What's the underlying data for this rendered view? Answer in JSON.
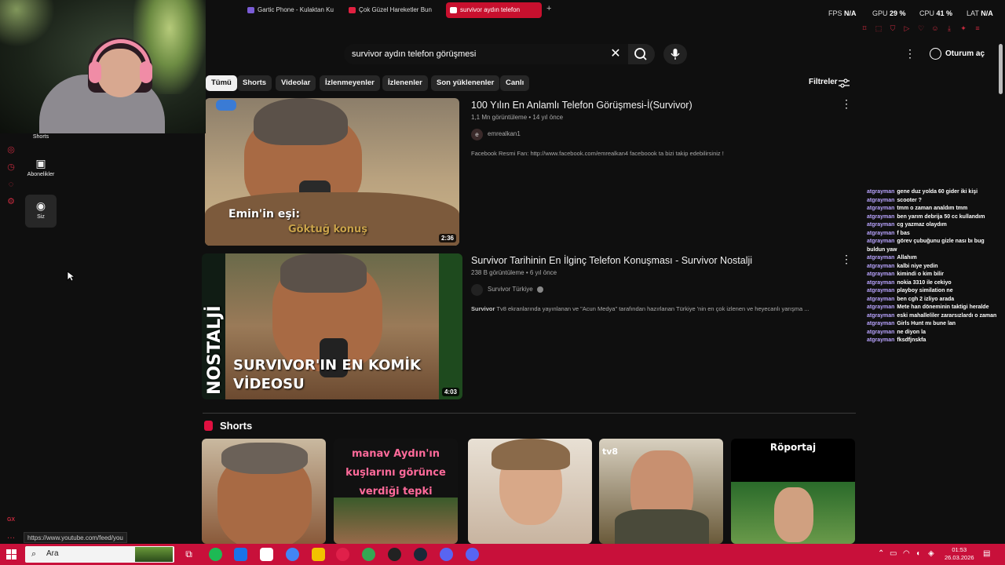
{
  "browser": {
    "tabs": [
      {
        "label": "Gartic Phone - Kulaktan Ku"
      },
      {
        "label": "Çok Güzel Hareketler Bun"
      },
      {
        "label": "survivor aydın telefon"
      }
    ],
    "stats": [
      {
        "label": "FPS",
        "value": "N/A"
      },
      {
        "label": "GPU",
        "value": "29 %"
      },
      {
        "label": "CPU",
        "value": "41 %"
      },
      {
        "label": "LAT",
        "value": "N/A"
      }
    ]
  },
  "sidebar": {
    "shorts_label": "Shorts",
    "subscriptions_label": "Abonelikler",
    "you_label": "Siz"
  },
  "search": {
    "query": "survivor aydın telefon görüşmesi"
  },
  "header": {
    "signin_label": "Oturum aç"
  },
  "chips": [
    "Tümü",
    "Shorts",
    "Videolar",
    "İzlenmeyenler",
    "İzlenenler",
    "Son yüklenenler",
    "Canlı"
  ],
  "filters_label": "Filtreler",
  "results": [
    {
      "title": "100 Yılın En Anlamlı Telefon Görüşmesi-İ(Survivor)",
      "meta": "1,1 Mn görüntüleme • 14 yıl önce",
      "channel": "emrealkan1",
      "channel_initial": "e",
      "description": "Facebook Resmi Fan: http://www.facebook.com/emrealkan4 faceboook ta bizi takip edebilirsiniz !",
      "duration": "2:36",
      "overlay_line1": "Emin'in eşi:",
      "overlay_line2": "Göktuğ konuş"
    },
    {
      "title": "Survivor Tarihinin En İlginç Telefon Konuşması - Survivor Nostalji",
      "meta": "238 B görüntüleme • 6 yıl önce",
      "channel": "Survivor Türkiye",
      "description_bold": "Survivor",
      "description": "Tv8 ekranlarında yayınlanan ve \"Acun Medya\" tarafından hazırlanan Türkiye 'nin en çok izlenen ve heyecanlı yarışma ...",
      "duration": "4:03",
      "overlay_side": "NOSTALJİ",
      "overlay_line1": "SURVIVOR'IN EN KOMİK",
      "overlay_line2": "VİDEOSU"
    }
  ],
  "shorts": {
    "heading": "Shorts",
    "items": [
      {
        "caption": ""
      },
      {
        "caption": "manav Aydın'ın kuşlarını görünce verdiği tepki"
      },
      {
        "caption": ""
      },
      {
        "caption": "tv8"
      },
      {
        "caption": "Röportaj"
      }
    ]
  },
  "chat": [
    {
      "user": "atgrayman",
      "msg": "gene duz yolda 60 gider iki kişi"
    },
    {
      "user": "atgrayman",
      "msg": "scooter ?"
    },
    {
      "user": "atgrayman",
      "msg": "tmm o zaman analdım tmm"
    },
    {
      "user": "atgrayman",
      "msg": "ben yarım debrija 50 cc kullandım"
    },
    {
      "user": "atgrayman",
      "msg": "cg yazmaz olaydım"
    },
    {
      "user": "atgrayman",
      "msg": "f bas"
    },
    {
      "user": "atgrayman",
      "msg": "görev çubuğunu gizle nası bı bug buldun yaw"
    },
    {
      "user": "atgrayman",
      "msg": "Allahım"
    },
    {
      "user": "atgrayman",
      "msg": "kalbi niye yedin"
    },
    {
      "user": "atgrayman",
      "msg": "kimindi o kim bilir"
    },
    {
      "user": "atgrayman",
      "msg": "nokia 3310 ile cekiyo"
    },
    {
      "user": "atgrayman",
      "msg": "playboy similation ne"
    },
    {
      "user": "atgrayman",
      "msg": "ben cgh 2 izliyo arada"
    },
    {
      "user": "atgrayman",
      "msg": "Mete han döneminin taktigi heralde"
    },
    {
      "user": "atgrayman",
      "msg": "eski mahalleliler zararsızlardı o zaman"
    },
    {
      "user": "atgrayman",
      "msg": "Girls Hunt mı bune lan"
    },
    {
      "user": "atgrayman",
      "msg": "ne diyon la"
    },
    {
      "user": "atgrayman",
      "msg": "fksdfjnskfa"
    }
  ],
  "status_url": "https://www.youtube.com/feed/you",
  "taskbar": {
    "search_placeholder": "Ara",
    "time": "01:53",
    "date": "26.03.2026"
  },
  "left_rail": {
    "gx_label": "GX"
  },
  "colors": {
    "accent": "#c8103a",
    "background": "#0f0f0f",
    "chip": "#272727",
    "chat_user": "#b9a4ff"
  }
}
